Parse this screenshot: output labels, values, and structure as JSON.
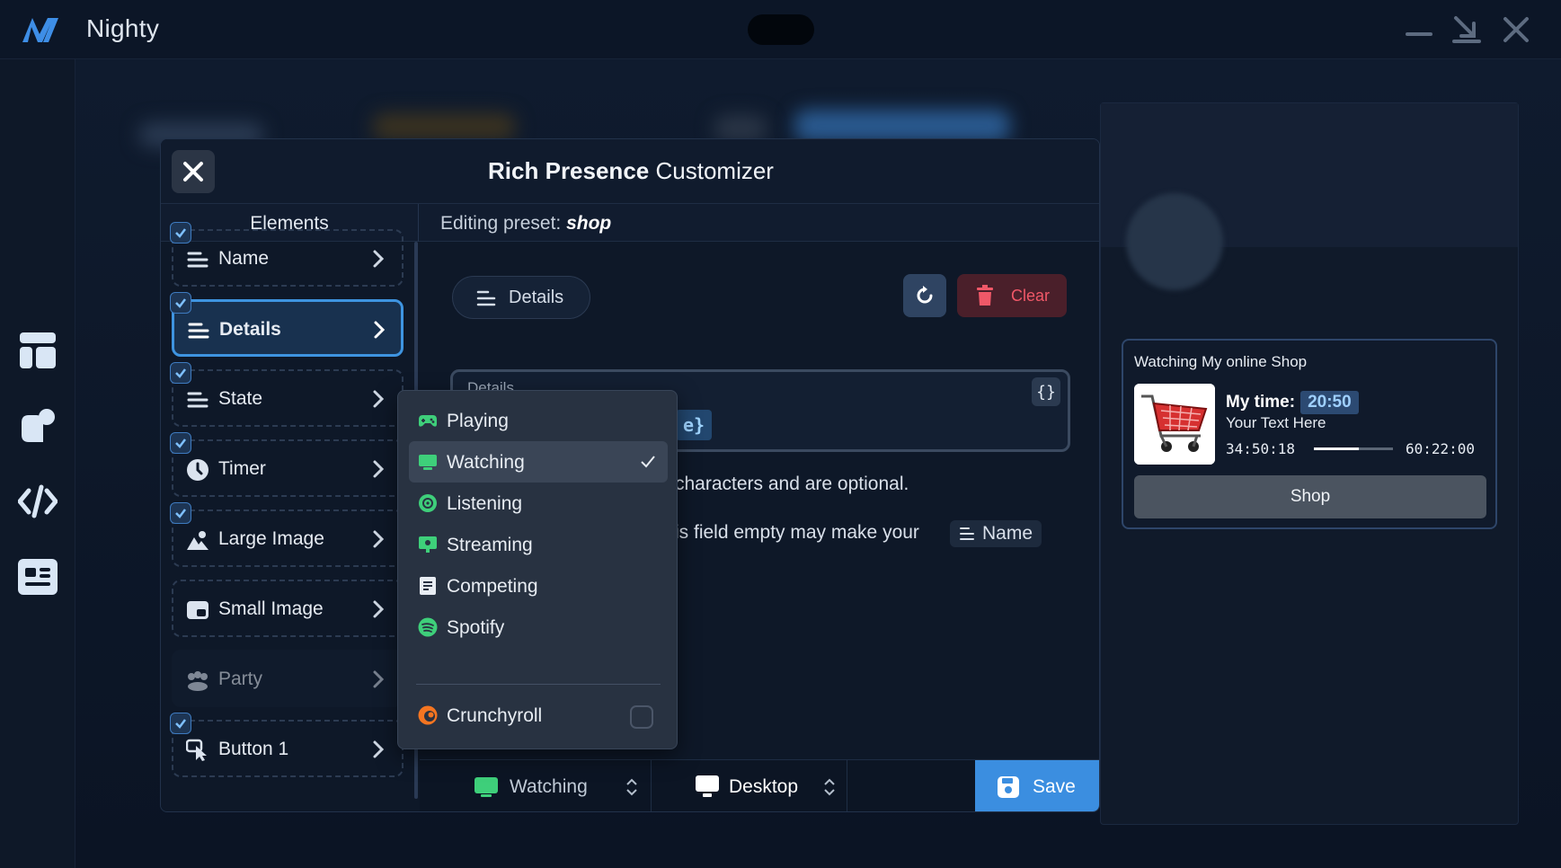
{
  "app": {
    "title": "Nighty"
  },
  "dialog": {
    "title_bold": "Rich Presence",
    "title_light": "Customizer",
    "elements_header": "Elements",
    "preset_prefix": "Editing preset:",
    "preset_name": "shop"
  },
  "elements": [
    {
      "label": "Name",
      "checked": true,
      "icon": "lines-icon"
    },
    {
      "label": "Details",
      "checked": true,
      "icon": "lines-icon",
      "active": true
    },
    {
      "label": "State",
      "checked": true,
      "icon": "lines-icon"
    },
    {
      "label": "Timer",
      "checked": true,
      "icon": "clock-icon"
    },
    {
      "label": "Large Image",
      "checked": true,
      "icon": "image-icon"
    },
    {
      "label": "Small Image",
      "checked": false,
      "icon": "small-image-icon"
    },
    {
      "label": "Party",
      "checked": false,
      "icon": "party-icon",
      "disabled": true
    },
    {
      "label": "Button 1",
      "checked": true,
      "icon": "pointer-icon"
    }
  ],
  "editor": {
    "section_chip": "Details",
    "clear_label": "Clear",
    "input_label": "Details",
    "input_value_fragment": "e}",
    "brace_label": "{}",
    "help_line1": "characters and are optional.",
    "help_line2": "is field empty may make your",
    "help_chip": "Name"
  },
  "bottombar": {
    "activity": "Watching",
    "platform": "Desktop",
    "save_label": "Save"
  },
  "activity_menu": {
    "items": [
      {
        "label": "Playing",
        "icon": "gamepad-icon",
        "color": "#3ecf7a"
      },
      {
        "label": "Watching",
        "icon": "screen-icon",
        "color": "#3ecf7a",
        "selected": true
      },
      {
        "label": "Listening",
        "icon": "headphones-icon",
        "color": "#3ecf7a"
      },
      {
        "label": "Streaming",
        "icon": "broadcast-icon",
        "color": "#3ecf7a"
      },
      {
        "label": "Competing",
        "icon": "document-icon",
        "color": "#e8edf3"
      },
      {
        "label": "Spotify",
        "icon": "spotify-icon",
        "color": "#3ecf7a"
      }
    ],
    "extra": {
      "label": "Crunchyroll",
      "icon": "crunchyroll-icon",
      "color": "#f47521",
      "checked": false
    }
  },
  "preview": {
    "header": "Watching  My online Shop",
    "line1_label": "My time:",
    "line1_time": "20:50",
    "line2": "Your Text Here",
    "elapsed": "34:50:18",
    "total": "60:22:00",
    "progress": 0.57,
    "button": "Shop"
  },
  "colors": {
    "accent": "#3b8ee0",
    "danger": "#f05868",
    "active_bg": "#18314f"
  }
}
